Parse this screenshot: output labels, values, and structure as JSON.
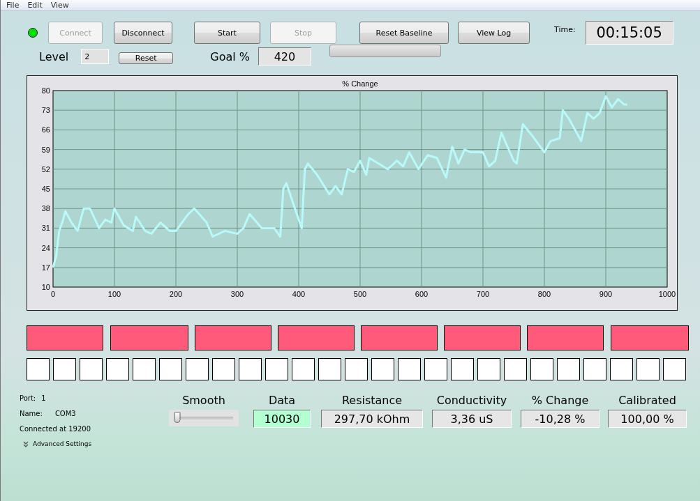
{
  "menu": [
    "File",
    "Edit",
    "View"
  ],
  "status_led": {
    "color": "#00e000"
  },
  "buttons": [
    {
      "label": "Connect",
      "disabled": true
    },
    {
      "label": "Disconnect",
      "disabled": false
    },
    {
      "label": "Start",
      "disabled": false
    },
    {
      "label": "Stop",
      "disabled": true
    },
    {
      "label": "Reset Baseline",
      "disabled": false
    },
    {
      "label": "View Log",
      "disabled": false
    }
  ],
  "time": {
    "label": "Time:",
    "value": "00:15:05"
  },
  "level": {
    "label": "Level",
    "value": "2",
    "reset": "Reset"
  },
  "goal": {
    "label": "Goal %",
    "value": "420"
  },
  "progress": {
    "level": 0
  },
  "chart": {
    "chart_data": {
      "type": "line",
      "title": "% Change",
      "grid": true,
      "xlim": [
        0,
        1000
      ],
      "ylim": [
        10,
        80
      ],
      "xticks": [
        0,
        100,
        200,
        300,
        400,
        500,
        600,
        700,
        800,
        900,
        1000
      ],
      "yticks": [
        10,
        17,
        24,
        31,
        38,
        45,
        52,
        59,
        66,
        73,
        80
      ],
      "x": [
        0,
        5,
        10,
        15,
        20,
        30,
        40,
        50,
        60,
        75,
        85,
        95,
        100,
        115,
        130,
        135,
        150,
        160,
        175,
        190,
        200,
        220,
        230,
        250,
        260,
        280,
        300,
        310,
        320,
        340,
        360,
        370,
        375,
        380,
        400,
        405,
        410,
        415,
        430,
        450,
        460,
        470,
        480,
        490,
        500,
        510,
        515,
        530,
        545,
        560,
        570,
        580,
        595,
        610,
        625,
        640,
        650,
        660,
        670,
        680,
        700,
        710,
        720,
        730,
        740,
        750,
        755,
        765,
        780,
        800,
        810,
        825,
        830,
        840,
        860,
        870,
        880,
        890,
        900,
        910,
        920,
        930,
        935
      ],
      "series": [
        {
          "color": "#b8fafa",
          "values": [
            17,
            21,
            30,
            33,
            37,
            33,
            30,
            38,
            38,
            31,
            34,
            33,
            38,
            32,
            30,
            35,
            30,
            29,
            33,
            30,
            30,
            36,
            38,
            33,
            28,
            30,
            29,
            31,
            36,
            31,
            31,
            28,
            45,
            47,
            34,
            31,
            52,
            54,
            50,
            43,
            46,
            43,
            52,
            51,
            55,
            50,
            56,
            54,
            52,
            55,
            53,
            58,
            52,
            57,
            56,
            49,
            60,
            54,
            59,
            58,
            58,
            53,
            55,
            65,
            60,
            55,
            54,
            68,
            64,
            58,
            62,
            63,
            73,
            70,
            62,
            72,
            70,
            72,
            78,
            74,
            77,
            75,
            75
          ]
        }
      ]
    }
  },
  "alarm_blocks": [
    {
      "color": "#ff5a7a"
    },
    {
      "color": "#ff5a7a"
    },
    {
      "color": "#ff5a7a"
    },
    {
      "color": "#ff5a7a"
    },
    {
      "color": "#ff5a7a"
    },
    {
      "color": "#ff5a7a"
    },
    {
      "color": "#ff5a7a"
    },
    {
      "color": "#ff5a7a"
    }
  ],
  "cells": [
    {
      "color": "#ffffff"
    },
    {
      "color": "#ffffff"
    },
    {
      "color": "#ffffff"
    },
    {
      "color": "#ffffff"
    },
    {
      "color": "#ffffff"
    },
    {
      "color": "#ffffff"
    },
    {
      "color": "#ffffff"
    },
    {
      "color": "#ffffff"
    },
    {
      "color": "#ffffff"
    },
    {
      "color": "#ffffff"
    },
    {
      "color": "#ffffff"
    },
    {
      "color": "#ffffff"
    },
    {
      "color": "#ffffff"
    },
    {
      "color": "#ffffff"
    },
    {
      "color": "#ffffff"
    },
    {
      "color": "#ffffff"
    },
    {
      "color": "#ffffff"
    },
    {
      "color": "#ffffff"
    },
    {
      "color": "#ffffff"
    },
    {
      "color": "#ffffff"
    },
    {
      "color": "#ffffff"
    },
    {
      "color": "#ffffff"
    },
    {
      "color": "#ffffff"
    },
    {
      "color": "#ffffff"
    },
    {
      "color": "#ffffff"
    }
  ],
  "port": {
    "port_label": "Port:",
    "port": "1",
    "name_label": "Name:",
    "name": "COM3",
    "connected": "Connected at 19200",
    "advanced": "Advanced Settings"
  },
  "smooth": {
    "label": "Smooth",
    "level": 0.05
  },
  "readouts": [
    {
      "label": "Data",
      "value": "10030",
      "highlight": true
    },
    {
      "label": "Resistance",
      "value": "297,70 kOhm",
      "highlight": false
    },
    {
      "label": "Conductivity",
      "value": "3,36 uS",
      "highlight": false
    },
    {
      "label": "% Change",
      "value": "-10,28 %",
      "highlight": false
    },
    {
      "label": "Calibrated",
      "value": "100,00 %",
      "highlight": false
    }
  ]
}
